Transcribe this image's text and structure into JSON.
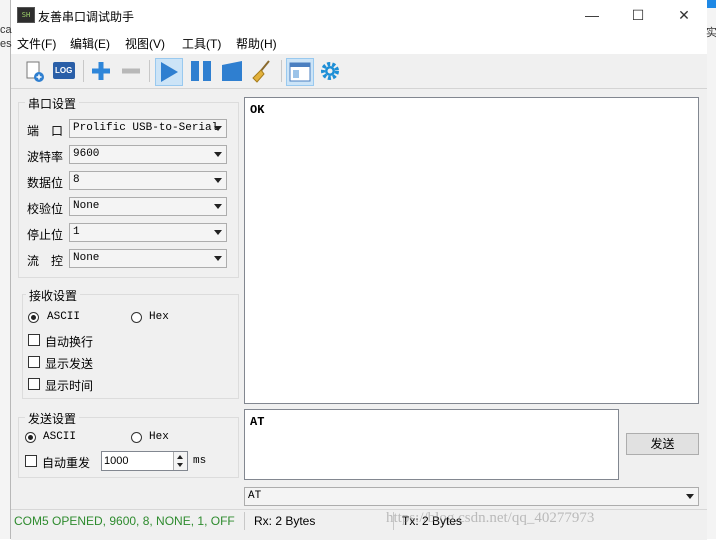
{
  "window": {
    "title": "友善串口调试助手",
    "minimize": "—",
    "maximize": "☐",
    "close": "✕"
  },
  "menu": [
    "文件(F)",
    "编辑(E)",
    "视图(V)",
    "工具(T)",
    "帮助(H)"
  ],
  "toolbar": {
    "log_label": "LOG"
  },
  "serial_settings": {
    "title": "串口设置",
    "rows": [
      {
        "label": "端　口",
        "value": "Prolific USB-to-Serial"
      },
      {
        "label": "波特率",
        "value": "9600"
      },
      {
        "label": "数据位",
        "value": "8"
      },
      {
        "label": "校验位",
        "value": "None"
      },
      {
        "label": "停止位",
        "value": "1"
      },
      {
        "label": "流　控",
        "value": "None"
      }
    ]
  },
  "receive_settings": {
    "title": "接收设置",
    "ascii_label": "ASCII",
    "hex_label": "Hex",
    "selected": "ASCII",
    "options": [
      {
        "label": "自动换行",
        "checked": false
      },
      {
        "label": "显示发送",
        "checked": false
      },
      {
        "label": "显示时间",
        "checked": false
      }
    ]
  },
  "send_settings": {
    "title": "发送设置",
    "ascii_label": "ASCII",
    "hex_label": "Hex",
    "selected": "ASCII",
    "auto_resend_label": "自动重发",
    "auto_resend_checked": false,
    "interval": "1000",
    "unit": "ms"
  },
  "receive_area": {
    "text": "OK"
  },
  "send_area": {
    "text": "AT"
  },
  "send_button": "发送",
  "history": {
    "selected": "AT"
  },
  "status": {
    "connection": "COM5 OPENED, 9600, 8, NONE, 1, OFF",
    "rx": "Rx: 2 Bytes",
    "tx": "Tx: 2 Bytes",
    "connection_color": "#2e8b2e"
  },
  "watermark": "https://blog.csdn.net/qq_40277973",
  "background_app": {
    "left_frag_1": "ca",
    "left_frag_2": "es",
    "right_frag": "实"
  }
}
